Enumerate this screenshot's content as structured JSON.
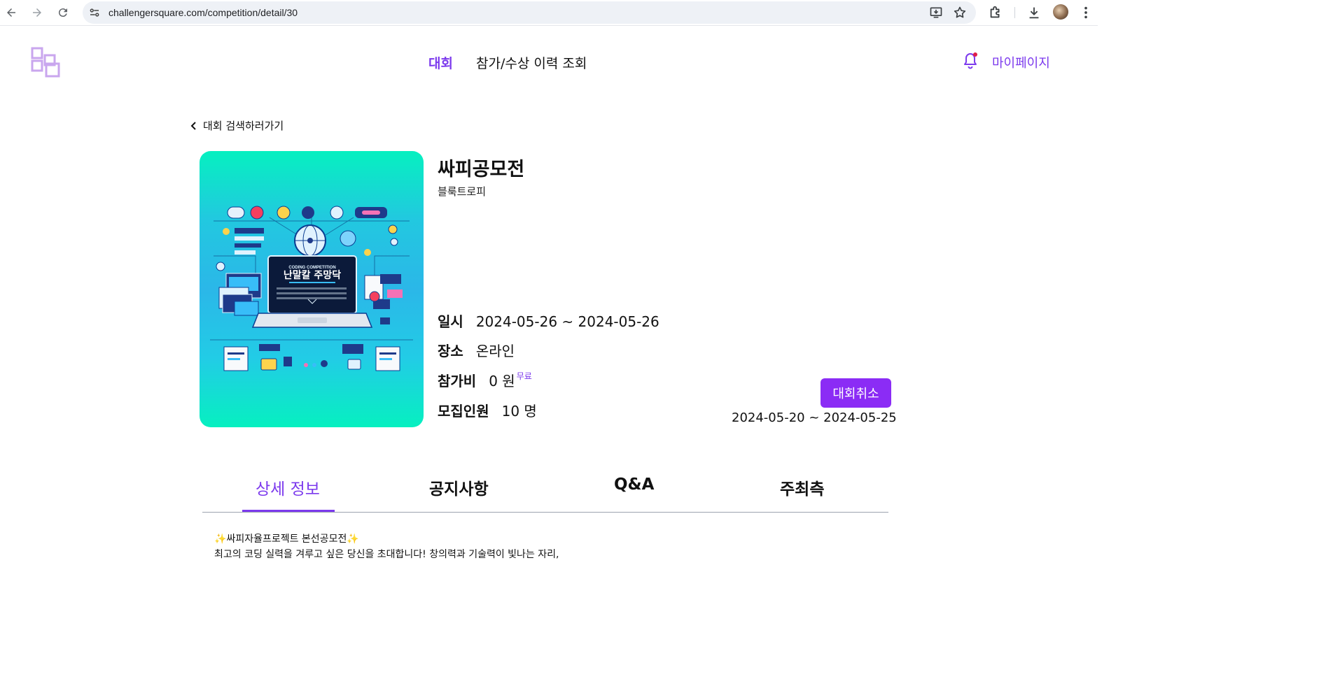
{
  "browser": {
    "url": "challengersquare.com/competition/detail/30"
  },
  "header": {
    "nav_active": "대회",
    "nav_history": "참가/수상 이력 조회",
    "mypage": "마이페이지"
  },
  "back_link": "대회 검색하러가기",
  "competition": {
    "title": "싸피공모전",
    "organizer": "블룩트로피",
    "poster_text_top": "CODING COMPETITION",
    "poster_text_main": "난말칼 주망닥",
    "date_label": "일시",
    "date_value": "2024-05-26 ~ 2024-05-26",
    "place_label": "장소",
    "place_value": "온라인",
    "fee_label": "참가비",
    "fee_value": "0 원",
    "fee_badge": "무료",
    "capacity_label": "모집인원",
    "capacity_value": "10 명",
    "cancel_button": "대회취소",
    "registration_period": "2024-05-20 ~ 2024-05-25"
  },
  "tabs": {
    "detail": "상세 정보",
    "notice": "공지사항",
    "qna": "Q&A",
    "host": "주최측"
  },
  "detail_text": {
    "line1": "싸피자율프로젝트 본선공모전",
    "line2": "최고의 코딩 실력을 겨루고 싶은 당신을 초대합니다! 창의력과 기술력이 빛나는 자리,"
  },
  "colors": {
    "accent": "#7c3aed",
    "button": "#8b2cf5"
  }
}
